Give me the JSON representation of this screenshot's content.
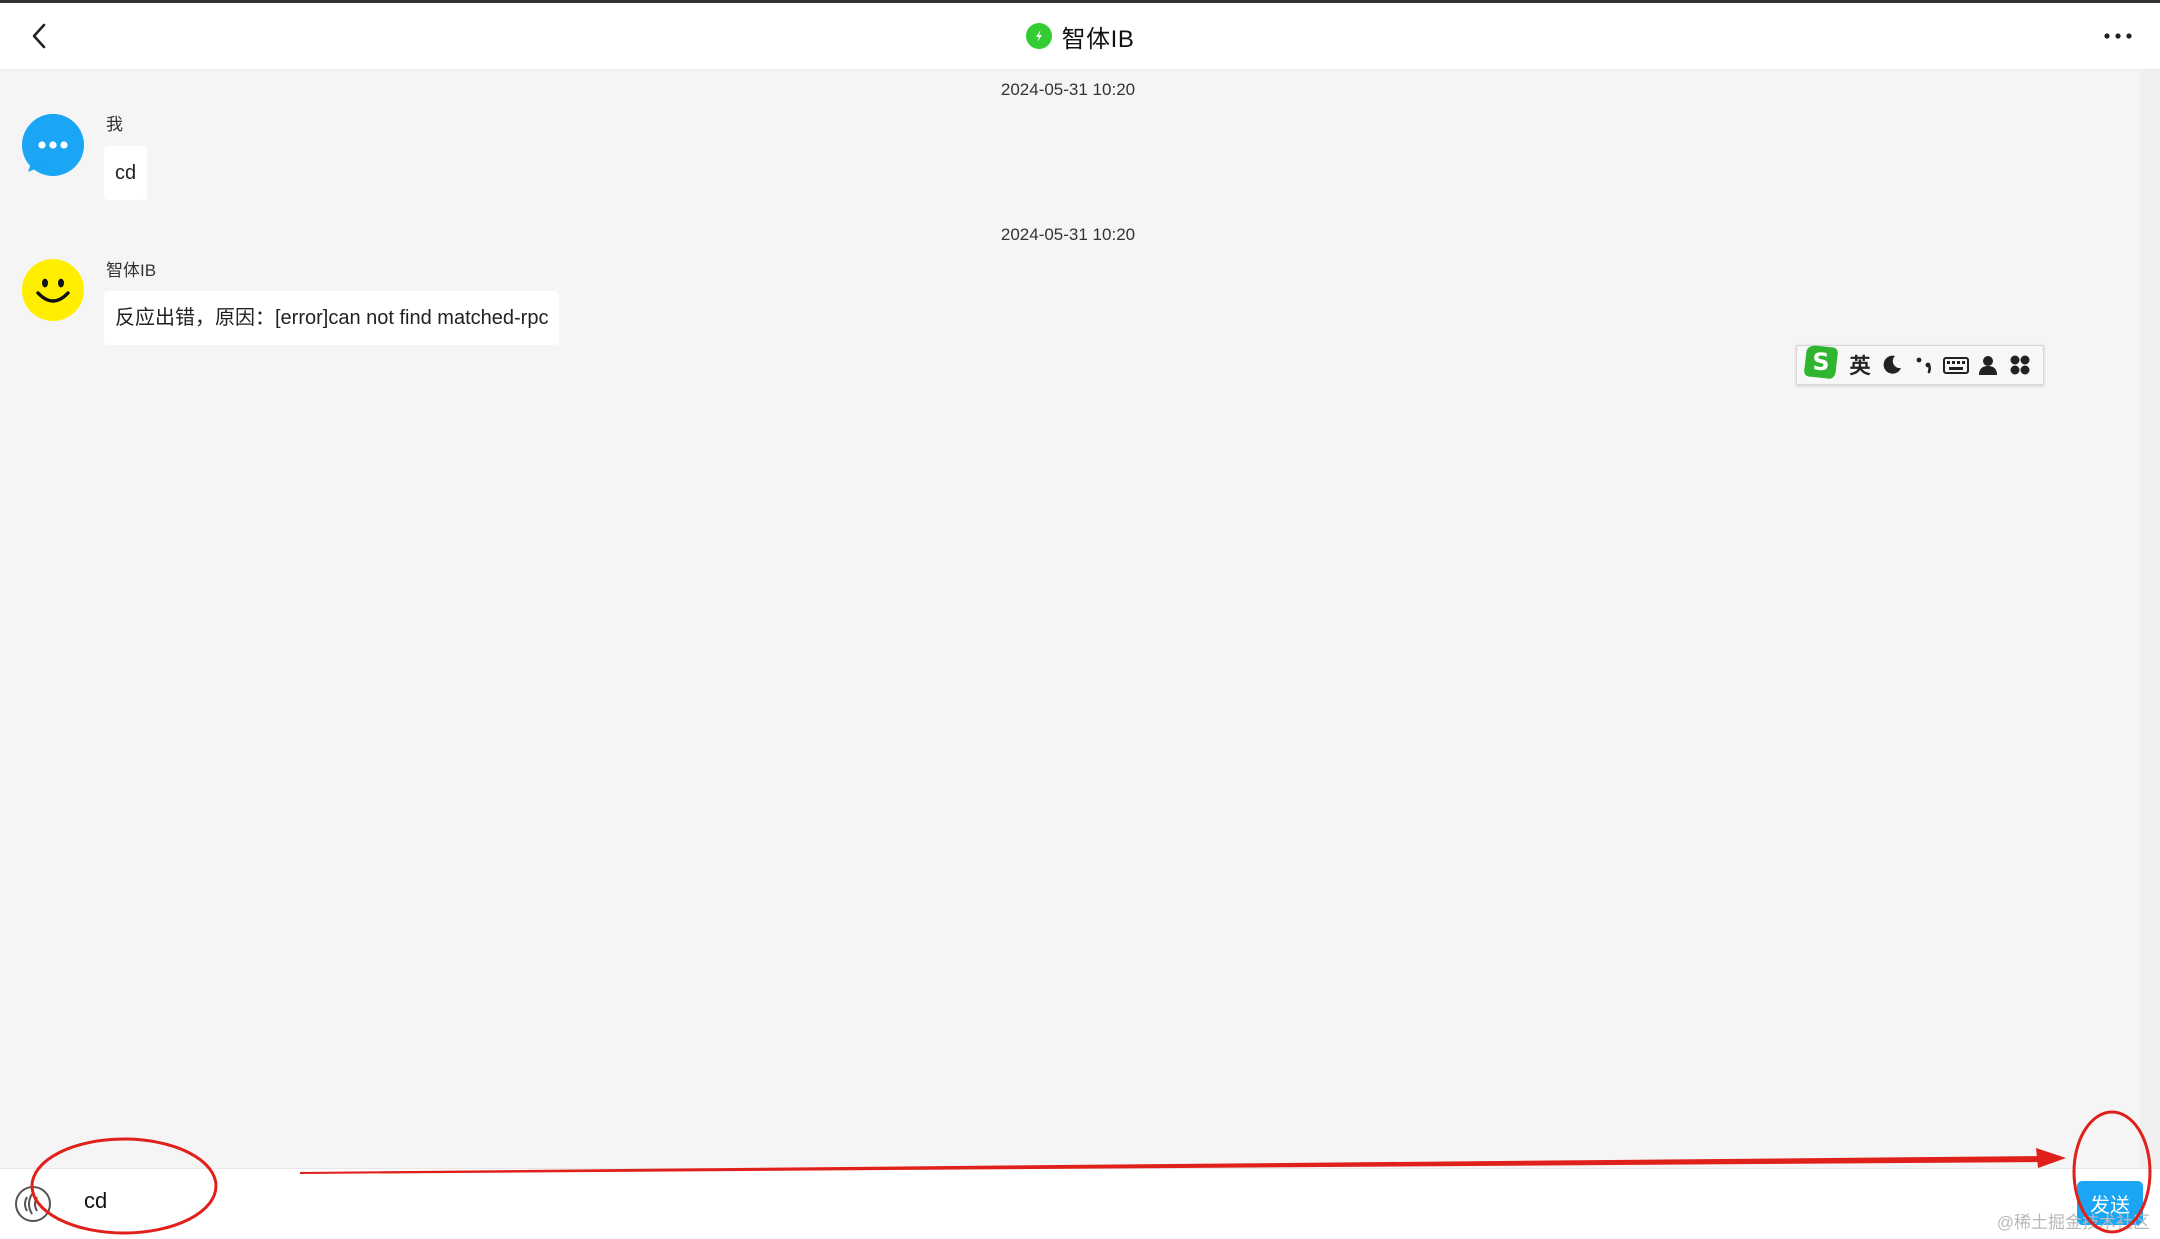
{
  "header": {
    "title": "智体IB",
    "status_color": "#33cc33"
  },
  "messages": [
    {
      "timestamp": "2024-05-31 10:20",
      "sender": "我",
      "text": "cd",
      "avatar": "chat-bubble-icon",
      "avatar_color": "#1aa5f5"
    },
    {
      "timestamp": "2024-05-31 10:20",
      "sender": "智体IB",
      "text": "反应出错，原因：[error]can not find matched-rpc",
      "avatar": "smiley-icon",
      "avatar_color": "#ffee00"
    }
  ],
  "ime_toolbar": {
    "logo": "S",
    "mode": "英",
    "icons": [
      "moon-icon",
      "punctuation-icon",
      "keyboard-icon",
      "user-icon",
      "grid-icon"
    ]
  },
  "composer": {
    "input_value": "cd",
    "send_label": "发送"
  },
  "watermark": "@稀土掘金技术社区",
  "accent_color": "#1aa5f5",
  "annotation_color": "#e0201a"
}
